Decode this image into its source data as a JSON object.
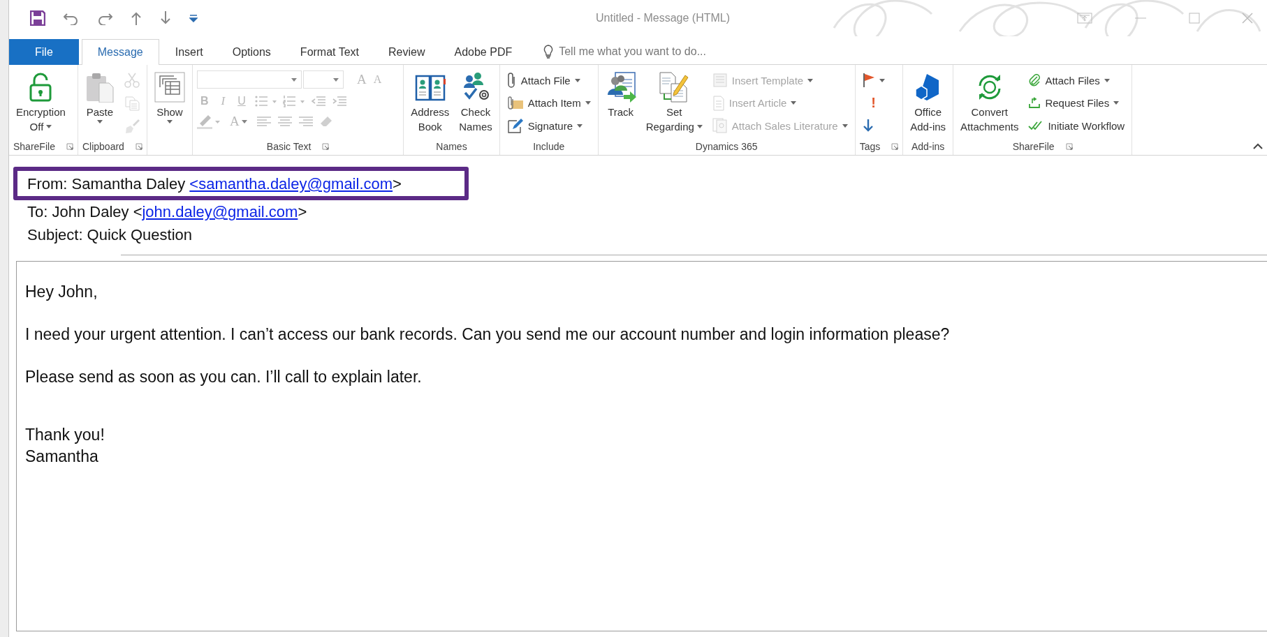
{
  "window": {
    "title": "Untitled - Message (HTML)"
  },
  "tabs": [
    {
      "label": "File",
      "kind": "file",
      "selected": false
    },
    {
      "label": "Message",
      "kind": "tab",
      "selected": true
    },
    {
      "label": "Insert",
      "kind": "tab",
      "selected": false
    },
    {
      "label": "Options",
      "kind": "tab",
      "selected": false
    },
    {
      "label": "Format Text",
      "kind": "tab",
      "selected": false
    },
    {
      "label": "Review",
      "kind": "tab",
      "selected": false
    },
    {
      "label": "Adobe PDF",
      "kind": "tab",
      "selected": false
    }
  ],
  "tell_me": {
    "placeholder": "Tell me what you want to do..."
  },
  "ribbon_groups": [
    {
      "label": "ShareFile",
      "launcher": true,
      "items": [
        {
          "kind": "large",
          "lines": [
            "Encryption",
            "Off"
          ],
          "dropdown": true,
          "disabled": false
        }
      ]
    },
    {
      "label": "Clipboard",
      "launcher": true,
      "items": [
        {
          "kind": "large",
          "lines": [
            "Paste"
          ],
          "dropdown": true,
          "disabled": false
        },
        {
          "kind": "icon",
          "disabled": true
        },
        {
          "kind": "icon",
          "disabled": true
        },
        {
          "kind": "icon",
          "disabled": true
        }
      ]
    },
    {
      "launcher": false,
      "items": [
        {
          "kind": "large",
          "lines": [
            "Show"
          ],
          "dropdown": true,
          "disabled": false
        }
      ]
    },
    {
      "label": "Basic Text",
      "launcher": true,
      "items": [
        {
          "kind": "format",
          "bold": "B",
          "italic": "I",
          "underline": "U",
          "font_color": "A",
          "grow": "A",
          "shrink": "A",
          "disabled": true
        }
      ]
    },
    {
      "label": "Names",
      "launcher": false,
      "items": [
        {
          "kind": "large",
          "lines": [
            "Address",
            "Book"
          ],
          "dropdown": false,
          "disabled": false
        },
        {
          "kind": "large",
          "lines": [
            "Check",
            "Names"
          ],
          "dropdown": false,
          "disabled": false
        }
      ]
    },
    {
      "label": "Include",
      "launcher": false,
      "items": [
        {
          "kind": "small",
          "lines": [
            "Attach File"
          ],
          "dropdown": true,
          "disabled": false
        },
        {
          "kind": "small",
          "lines": [
            "Attach Item"
          ],
          "dropdown": true,
          "disabled": false
        },
        {
          "kind": "small",
          "lines": [
            "Signature"
          ],
          "dropdown": true,
          "disabled": false
        }
      ]
    },
    {
      "label": "Dynamics 365",
      "launcher": false,
      "items": [
        {
          "kind": "large",
          "lines": [
            "Track"
          ],
          "dropdown": false,
          "disabled": false
        },
        {
          "kind": "large",
          "lines": [
            "Set",
            "Regarding"
          ],
          "dropdown": true,
          "disabled": false
        },
        {
          "kind": "small",
          "lines": [
            "Insert Template"
          ],
          "dropdown": true,
          "disabled": true
        },
        {
          "kind": "small",
          "lines": [
            "Insert Article"
          ],
          "dropdown": true,
          "disabled": true
        },
        {
          "kind": "small",
          "lines": [
            "Attach Sales Literature"
          ],
          "dropdown": true,
          "disabled": true
        }
      ]
    },
    {
      "label": "Tags",
      "launcher": true,
      "items": [
        {
          "kind": "icon",
          "dropdown": true,
          "disabled": false
        },
        {
          "kind": "glyph",
          "text": "!",
          "disabled": false
        },
        {
          "kind": "icon",
          "dropdown": false,
          "disabled": false
        }
      ]
    },
    {
      "label": "Add-ins",
      "launcher": false,
      "items": [
        {
          "kind": "large",
          "lines": [
            "Office",
            "Add-ins"
          ],
          "dropdown": false,
          "disabled": false
        }
      ]
    },
    {
      "label": "ShareFile",
      "launcher": true,
      "items": [
        {
          "kind": "large",
          "lines": [
            "Convert",
            "Attachments"
          ],
          "dropdown": false,
          "disabled": false
        },
        {
          "kind": "small",
          "lines": [
            "Attach Files"
          ],
          "dropdown": true,
          "disabled": false
        },
        {
          "kind": "small",
          "lines": [
            "Request Files"
          ],
          "dropdown": true,
          "disabled": false
        },
        {
          "kind": "small",
          "lines": [
            "Initiate Workflow"
          ],
          "dropdown": false,
          "disabled": false
        }
      ]
    }
  ],
  "header": {
    "fields": [
      {
        "text": "From: Samantha Daley ",
        "link": "<samantha.daley@gmail.com",
        "after": ">",
        "highlighted": true
      },
      {
        "text": "To: John Daley <",
        "link": "john.daley@gmail.com",
        "after": ">",
        "highlighted": false
      },
      {
        "text": "Subject: Quick Question",
        "highlighted": false
      }
    ]
  },
  "body": {
    "paragraphs": [
      {
        "lines": [
          "Hey John,"
        ]
      },
      {
        "lines": [
          "I need your urgent attention. I can’t access our bank records. Can you send me our account number and login information please?"
        ]
      },
      {
        "lines": [
          "Please send as soon as you can. I’ll call to explain later."
        ]
      },
      {
        "lines": [
          "Thank you!",
          "Samantha"
        ]
      }
    ]
  }
}
